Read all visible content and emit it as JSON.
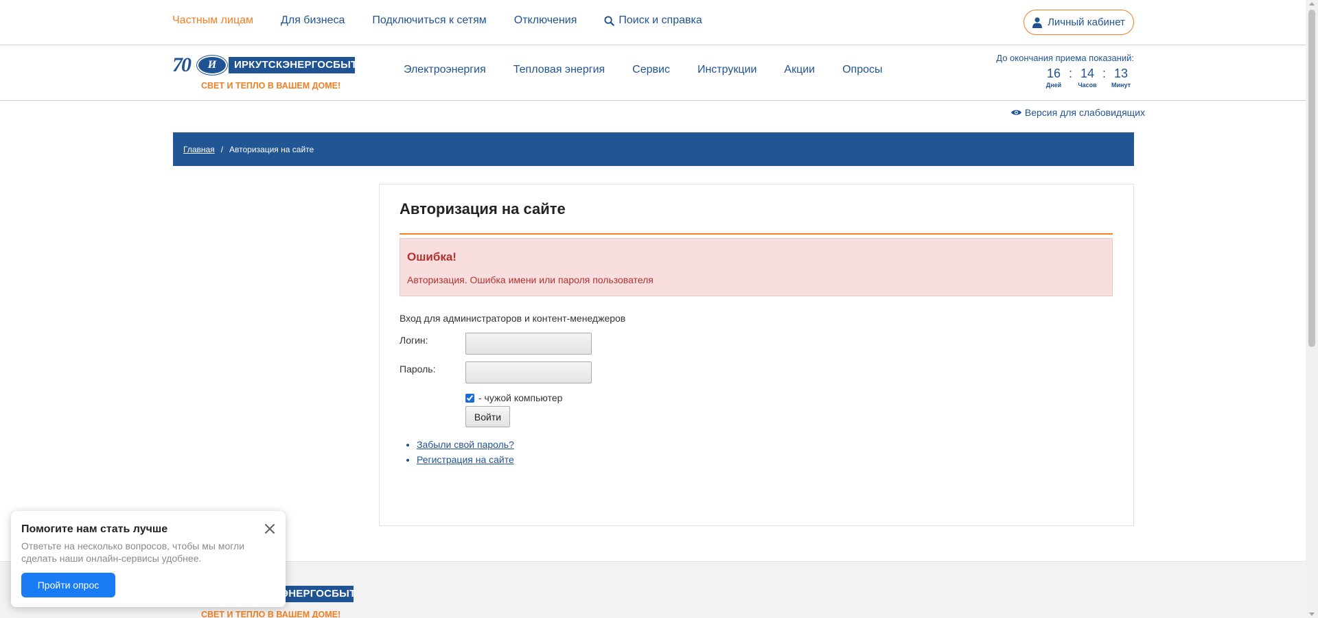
{
  "topnav": {
    "items": [
      {
        "label": "Частным лицам",
        "active": true
      },
      {
        "label": "Для бизнеса"
      },
      {
        "label": "Подключиться к сетям"
      },
      {
        "label": "Отключения"
      },
      {
        "label": "Поиск и справка",
        "icon": "search-icon"
      }
    ],
    "cabinet_label": "Личный кабинет"
  },
  "logo": {
    "anniversary": "70",
    "initial": "И",
    "name": "ИРКУТСКЭНЕРГОСБЫТ",
    "slogan": "СВЕТ И ТЕПЛО В ВАШЕМ ДОМЕ!"
  },
  "mainnav": [
    "Электроэнергия",
    "Тепловая энергия",
    "Сервис",
    "Инструкции",
    "Акции",
    "Опросы"
  ],
  "countdown": {
    "title": "До окончания приема показаний:",
    "days": "16",
    "hours": "14",
    "minutes": "13",
    "days_label": "Дней",
    "hours_label": "Часов",
    "minutes_label": "Минут",
    "separator": ":"
  },
  "low_vision_label": "Версия для слабовидящих",
  "breadcrumb": {
    "home": "Главная",
    "separator": "/",
    "current": "Авторизация на сайте"
  },
  "auth": {
    "title": "Авторизация на сайте",
    "error_title": "Ошибка!",
    "error_text": "Авторизация. Ошибка имени или пароля пользователя",
    "intro": "Вход для администраторов и контент-менеджеров",
    "login_label": "Логин:",
    "login_value": "",
    "password_label": "Пароль:",
    "password_value": "",
    "foreign_computer_label": "- чужой компьютер",
    "foreign_computer_checked": true,
    "submit_label": "Войти",
    "forgot_link": "Забыли свой пароль?",
    "register_link": "Регистрация на сайте"
  },
  "popup": {
    "title": "Помогите нам стать лучше",
    "text": "Ответьте на несколько вопросов, чтобы мы могли сделать наши онлайн-сервисы удобнее.",
    "button": "Пройти опрос"
  },
  "colors": {
    "brand_blue": "#1f5394",
    "accent_orange": "#f07f22",
    "breadcrumb_bg": "#225593",
    "error_bg": "#f8dedf",
    "error_text": "#b3322d",
    "popup_button": "#1a7cf5"
  }
}
